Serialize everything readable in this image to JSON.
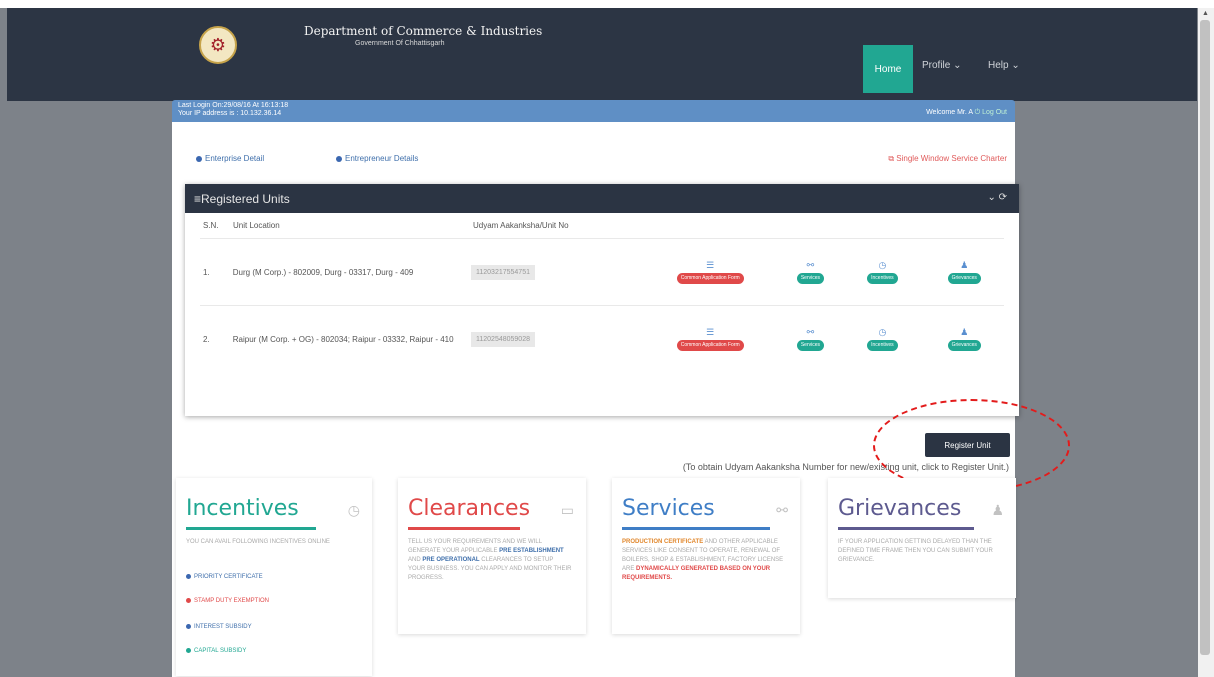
{
  "header": {
    "dept_title": "Department of Commerce & Industries",
    "govt_subtitle": "Government Of Chhattisgarh",
    "nav": [
      {
        "label": "Home"
      },
      {
        "label": "Profile ⌄"
      },
      {
        "label": "Help ⌄"
      }
    ]
  },
  "infobar": {
    "last_login": "Last Login On:29/08/16 At 16:13:18",
    "ip": "Your IP address is : 10.132.36.14",
    "welcome": "Welcome Mr. A",
    "logout": "Log Out"
  },
  "links": {
    "enterprise": "Enterprise Detail",
    "entrepreneur": "Entrepreneur Details",
    "charter": "Single Window Service Charter"
  },
  "units": {
    "title": "Registered Units",
    "columns": {
      "sn": "S.N.",
      "loc": "Unit Location",
      "udyam": "Udyam Aakanksha/Unit No"
    },
    "rows": [
      {
        "sn": "1.",
        "loc": "Durg (M Corp.) - 802009, Durg - 03317, Durg - 409",
        "udyam": "11203217554751"
      },
      {
        "sn": "2.",
        "loc": "Raipur (M Corp. + OG) - 802034; Raipur - 03332, Raipur - 410",
        "udyam": "11202548059028"
      }
    ],
    "actions": {
      "caf": "Common Application Form",
      "services": "Services",
      "incentives": "Incentives",
      "grievances": "Grievances"
    }
  },
  "register": {
    "button": "Register Unit",
    "note": "(To obtain Udyam Aakanksha Number for new/existing unit, click to Register Unit.)"
  },
  "cards": {
    "incentives": {
      "title": "Incentives",
      "text": "YOU CAN AVAIL FOLLOWING INCENTIVES ONLINE",
      "items": [
        "PRIORITY CERTIFICATE",
        "STAMP DUTY EXEMPTION",
        "INTEREST SUBSIDY",
        "CAPITAL SUBSIDY"
      ]
    },
    "clearances": {
      "title": "Clearances",
      "text_a": "TELL US YOUR REQUIREMENTS AND WE WILL GENERATE YOUR APPLICABLE",
      "text_b": "PRE ESTABLISHMENT",
      "text_c": "AND",
      "text_d": "PRE OPERATIONAL",
      "text_e": "CLEARANCES TO SETUP YOUR BUSINESS. YOU CAN APPLY AND MONITOR THEIR PROGRESS."
    },
    "services": {
      "title": "Services",
      "text_a": "PRODUCTION CERTIFICATE",
      "text_b": "AND OTHER APPLICABLE SERVICES LIKE CONSENT TO OPERATE, RENEWAL OF BOILERS, SHOP & ESTABLISHMENT, FACTORY LICENSE ARE",
      "text_c": "DYNAMICALLY GENERATED BASED ON YOUR REQUIREMENTS."
    },
    "grievances": {
      "title": "Grievances",
      "text": "IF YOUR APPLICATION GETTING DELAYED THAN THE DEFINED TIME FRAME THEN YOU CAN SUBMIT YOUR GRIEVANCE."
    }
  },
  "colors": {
    "navbar": "#2c3544",
    "accent": "#21a792",
    "danger": "#e04949",
    "link": "#3f6fab",
    "page_bg": "#7d8289"
  }
}
